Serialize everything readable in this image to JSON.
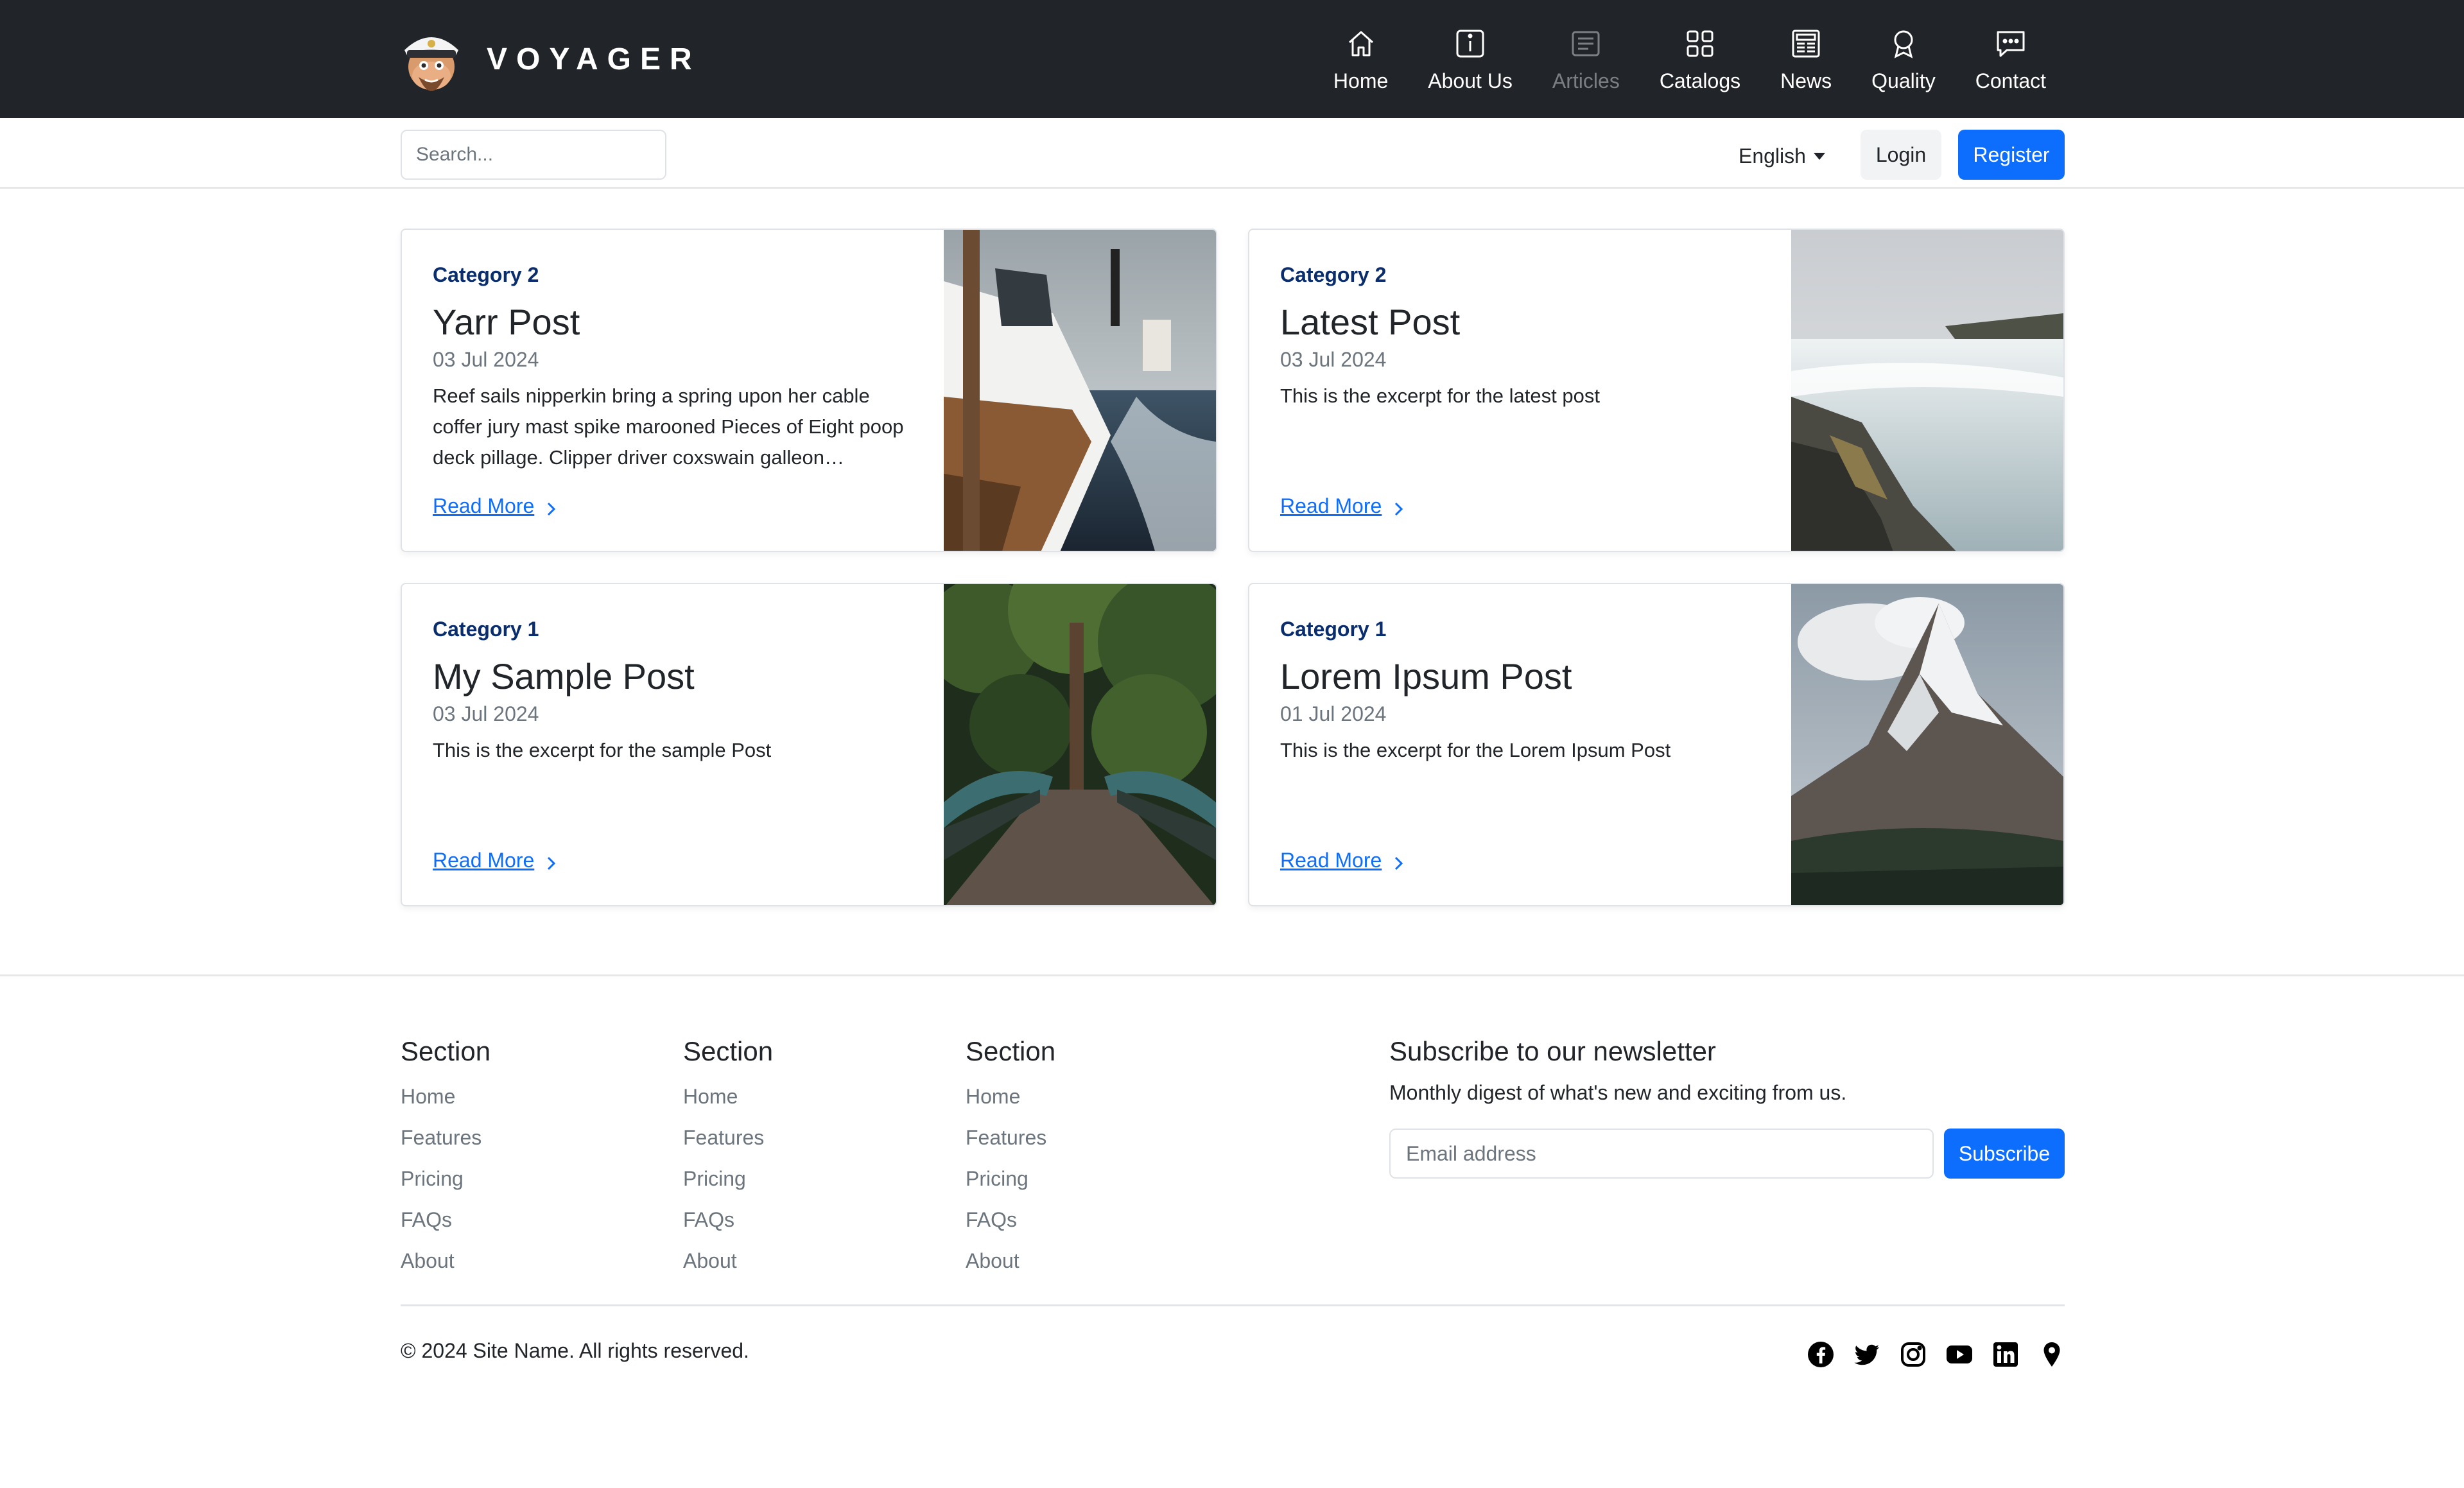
{
  "brand": {
    "name": "VOYAGER"
  },
  "nav": [
    {
      "label": "Home",
      "icon": "home-icon"
    },
    {
      "label": "About Us",
      "icon": "info-icon"
    },
    {
      "label": "Articles",
      "icon": "articles-icon",
      "disabled": true
    },
    {
      "label": "Catalogs",
      "icon": "grid-icon"
    },
    {
      "label": "News",
      "icon": "newspaper-icon"
    },
    {
      "label": "Quality",
      "icon": "award-icon"
    },
    {
      "label": "Contact",
      "icon": "chat-icon"
    }
  ],
  "subbar": {
    "search_placeholder": "Search...",
    "language": "English",
    "login": "Login",
    "register": "Register"
  },
  "posts": [
    {
      "category": "Category 2",
      "title": "Yarr Post",
      "date": "03 Jul 2024",
      "excerpt": "Reef sails nipperkin bring a spring upon her cable coffer jury mast spike marooned Pieces of Eight poop deck pillage. Clipper driver coxswain galleon…",
      "read_more": "Read More",
      "image": "yacht-photo"
    },
    {
      "category": "Category 2",
      "title": "Latest Post",
      "date": "03 Jul 2024",
      "excerpt": "This is the excerpt for the latest post",
      "read_more": "Read More",
      "image": "waterfall-photo"
    },
    {
      "category": "Category 1",
      "title": "My Sample Post",
      "date": "03 Jul 2024",
      "excerpt": "This is the excerpt for the sample Post",
      "read_more": "Read More",
      "image": "forest-bridge-photo"
    },
    {
      "category": "Category 1",
      "title": "Lorem Ipsum Post",
      "date": "01 Jul 2024",
      "excerpt": "This is the excerpt for the Lorem Ipsum Post",
      "read_more": "Read More",
      "image": "mountain-photo"
    }
  ],
  "footer": {
    "sections": [
      {
        "title": "Section",
        "links": [
          "Home",
          "Features",
          "Pricing",
          "FAQs",
          "About"
        ]
      },
      {
        "title": "Section",
        "links": [
          "Home",
          "Features",
          "Pricing",
          "FAQs",
          "About"
        ]
      },
      {
        "title": "Section",
        "links": [
          "Home",
          "Features",
          "Pricing",
          "FAQs",
          "About"
        ]
      }
    ],
    "newsletter": {
      "title": "Subscribe to our newsletter",
      "text": "Monthly digest of what's new and exciting from us.",
      "email_placeholder": "Email address",
      "button": "Subscribe"
    },
    "copyright": "© 2024 Site Name. All rights reserved.",
    "social": [
      "facebook-icon",
      "twitter-icon",
      "instagram-icon",
      "youtube-icon",
      "linkedin-icon",
      "map-pin-icon"
    ]
  },
  "colors": {
    "nav_bg": "#212529",
    "primary": "#0d6efd",
    "category": "#0a2d6e",
    "muted": "#6c757d"
  }
}
